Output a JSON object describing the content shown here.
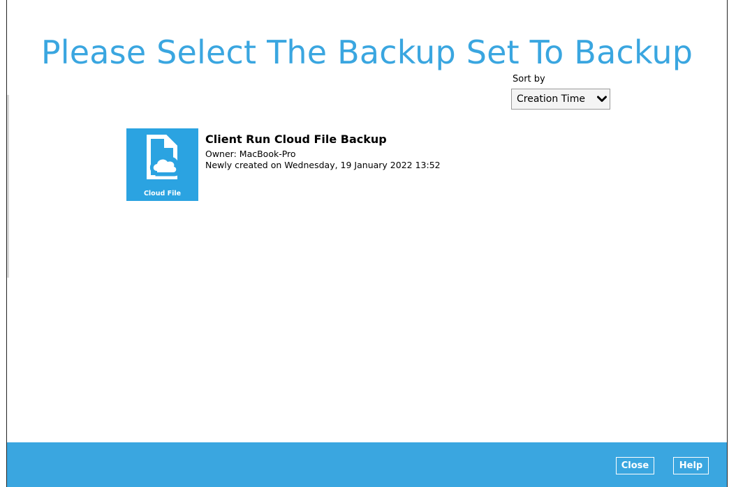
{
  "page": {
    "title": "Please Select The Backup Set To Backup"
  },
  "sort": {
    "label": "Sort by",
    "selected": "Creation Time"
  },
  "backup_sets": [
    {
      "tile_label": "Cloud File",
      "tile_icon": "cloud-file-icon",
      "name": "Client Run Cloud File Backup",
      "owner": "Owner: MacBook-Pro",
      "created": "Newly created on Wednesday, 19 January 2022 13:52"
    }
  ],
  "footer": {
    "close_label": "Close",
    "help_label": "Help"
  },
  "colors": {
    "accent": "#3aa6e0",
    "tile": "#2ba3e1",
    "text": "#000000"
  }
}
